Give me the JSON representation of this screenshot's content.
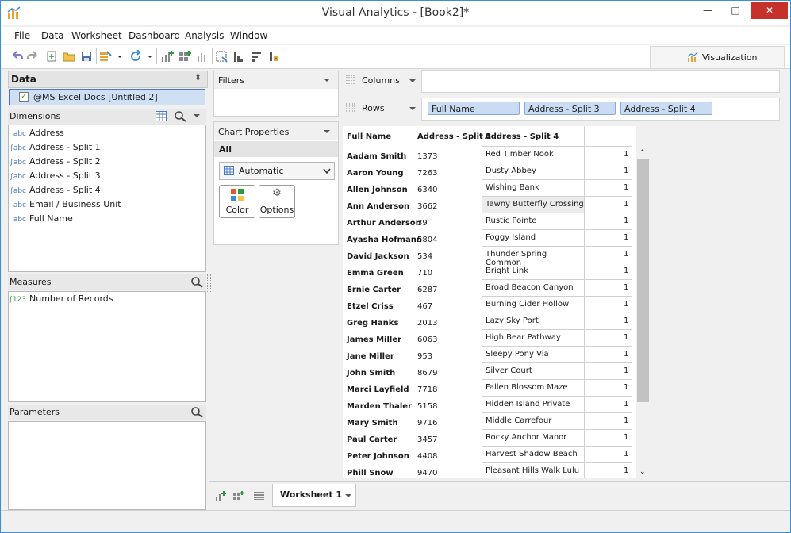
{
  "window": {
    "title": "Visual Analytics - [Book2]*"
  },
  "menu": [
    "File",
    "Data",
    "Worksheet",
    "Dashboard",
    "Analysis",
    "Window"
  ],
  "visualization_tab": {
    "label": "Visualization"
  },
  "data_panel": {
    "title": "Data",
    "datasource": "@MS Excel Docs [Untitled 2]"
  },
  "dimensions": {
    "title": "Dimensions",
    "items": [
      {
        "label": "Address",
        "type": "abc"
      },
      {
        "label": "Address - Split 1",
        "type": "abc"
      },
      {
        "label": "Address - Split 2",
        "type": "abc"
      },
      {
        "label": "Address - Split 3",
        "type": "abc"
      },
      {
        "label": "Address - Split 4",
        "type": "abc"
      },
      {
        "label": "Email / Business Unit",
        "type": "abc"
      },
      {
        "label": "Full Name",
        "type": "abc"
      }
    ]
  },
  "measures": {
    "title": "Measures",
    "items": [
      {
        "label": "Number of Records",
        "type": "123"
      }
    ]
  },
  "parameters": {
    "title": "Parameters"
  },
  "filters": {
    "title": "Filters"
  },
  "chart_properties": {
    "title": "Chart Properties",
    "all_label": "All",
    "mark_type": "Automatic",
    "color_label": "Color",
    "options_label": "Options"
  },
  "shelves": {
    "columns_label": "Columns",
    "rows_label": "Rows",
    "rows_pills": [
      "Full Name",
      "Address - Split 3",
      "Address - Split 4"
    ]
  },
  "table": {
    "headers": [
      "Full Name",
      "Address - Split 3",
      "Address - Split 4"
    ],
    "rows": [
      {
        "name": "Aadam Smith",
        "split3": "1373",
        "split4": "Red Timber Nook",
        "count": "1"
      },
      {
        "name": "Aaron Young",
        "split3": "7263",
        "split4": "Dusty Abbey",
        "count": "1"
      },
      {
        "name": "Allen Johnson",
        "split3": "6340",
        "split4": "Wishing Bank",
        "count": "1"
      },
      {
        "name": "Ann Anderson",
        "split3": "3662",
        "split4": "Tawny Butterfly Crossing",
        "count": "1"
      },
      {
        "name": "Arthur Anderson",
        "split3": "39",
        "split4": "Rustic Pointe",
        "count": "1"
      },
      {
        "name": "Ayasha Hofmann",
        "split3": "5804",
        "split4": "Foggy Island",
        "count": "1"
      },
      {
        "name": "David Jackson",
        "split3": "534",
        "split4": "Thunder Spring Common",
        "count": "1"
      },
      {
        "name": "Emma Green",
        "split3": "710",
        "split4": "Bright Link",
        "count": "1"
      },
      {
        "name": "Ernie Carter",
        "split3": "6287",
        "split4": "Broad Beacon Canyon",
        "count": "1"
      },
      {
        "name": "Etzel Criss",
        "split3": "467",
        "split4": "Burning Cider Hollow",
        "count": "1"
      },
      {
        "name": "Greg Hanks",
        "split3": "2013",
        "split4": "Lazy Sky Port",
        "count": "1"
      },
      {
        "name": "James Miller",
        "split3": "6063",
        "split4": "High Bear Pathway",
        "count": "1"
      },
      {
        "name": "Jane Miller",
        "split3": "953",
        "split4": "Sleepy Pony Via",
        "count": "1"
      },
      {
        "name": "John Smith",
        "split3": "8679",
        "split4": "Silver Court",
        "count": "1"
      },
      {
        "name": "Marci Layfield",
        "split3": "7718",
        "split4": "Fallen Blossom Maze",
        "count": "1"
      },
      {
        "name": "Marden Thaler",
        "split3": "5158",
        "split4": "Hidden Island Private",
        "count": "1"
      },
      {
        "name": "Mary Smith",
        "split3": "9716",
        "split4": "Middle Carrefour",
        "count": "1"
      },
      {
        "name": "Paul Carter",
        "split3": "3457",
        "split4": "Rocky Anchor Manor",
        "count": "1"
      },
      {
        "name": "Peter Johnson",
        "split3": "4408",
        "split4": "Harvest Shadow Beach",
        "count": "1"
      },
      {
        "name": "Phill Snow",
        "split3": "9470",
        "split4": "Pleasant Hills Walk Lulu",
        "count": "1"
      }
    ]
  },
  "sheets": {
    "active": "Worksheet 1"
  },
  "colors": {
    "accent": "#3c8fd6",
    "close": "#c7312c",
    "pill": "#c9dcf3",
    "selection": "#cfe0f5"
  }
}
